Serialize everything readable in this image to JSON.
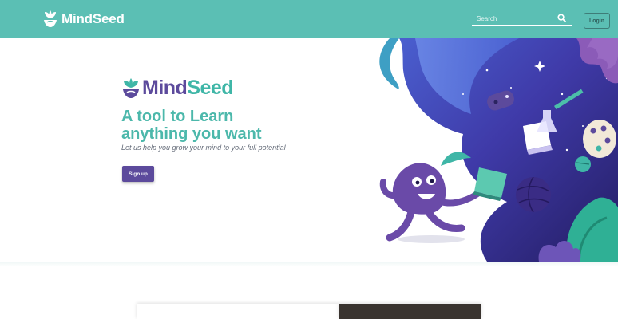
{
  "header": {
    "brand": "MindSeed",
    "search": {
      "placeholder": "Search",
      "value": ""
    },
    "login_label": "Login"
  },
  "hero": {
    "logo": {
      "part1": "Mind",
      "part2": "Seed"
    },
    "headline_line1": "A tool to Learn",
    "headline_line2": "anything you want",
    "tagline": "Let us help you grow your mind to your full potential",
    "signup_label": "Sign up"
  },
  "colors": {
    "header_bg": "#5bbfb4",
    "brand_purple": "#5c4a9c",
    "brand_teal": "#3fb6a7",
    "headline_teal": "#4cb8ab"
  },
  "icons": [
    "seedling-logo-icon",
    "search-icon"
  ]
}
